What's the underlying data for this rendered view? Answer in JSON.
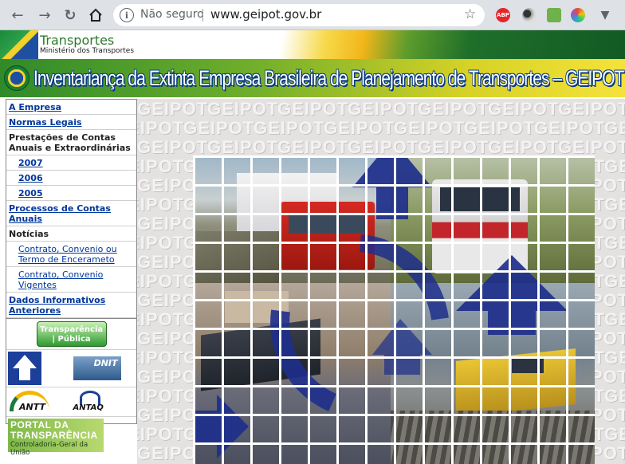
{
  "browser": {
    "security_text": "Não seguro",
    "url": "www.geipot.gov.br",
    "ext_abp": "ABP",
    "icons": [
      "back-arrow-icon",
      "forward-arrow-icon",
      "reload-icon",
      "home-icon",
      "info-icon",
      "star-icon",
      "menu-icon"
    ]
  },
  "header": {
    "ministry_title": "Transportes",
    "ministry_subtitle": "Ministério dos Transportes",
    "banner_title": "Inventariança da Extinta Empresa Brasileira de Planejamento de Transportes – GEIPOT"
  },
  "sidebar": {
    "items": [
      {
        "label": "A Empresa"
      },
      {
        "label": "Normas Legais"
      },
      {
        "label": "Prestações de Contas Anuais e Extraordinárias"
      },
      {
        "label": "2007"
      },
      {
        "label": "2006"
      },
      {
        "label": "2005"
      },
      {
        "label": "Processos de Contas Anuais"
      },
      {
        "label": "Notícias"
      },
      {
        "label": "Contrato, Convenio ou Termo de Encerameto"
      },
      {
        "label": "Contrato, Convenio Vigentes"
      },
      {
        "label": "Dados Informativos Anteriores"
      }
    ],
    "logos": {
      "transparencia_line1": "Transparência",
      "transparencia_line2": "| Pública",
      "dnit": "DNIT",
      "antt": "ANTT",
      "antaq": "ANTAQ",
      "portal_line1": "PORTAL DA",
      "portal_line2": "TRANSPARÊNCIA",
      "portal_line3": "Controladoria-Geral da União"
    }
  },
  "main": {
    "watermark": "GEIPOT"
  }
}
